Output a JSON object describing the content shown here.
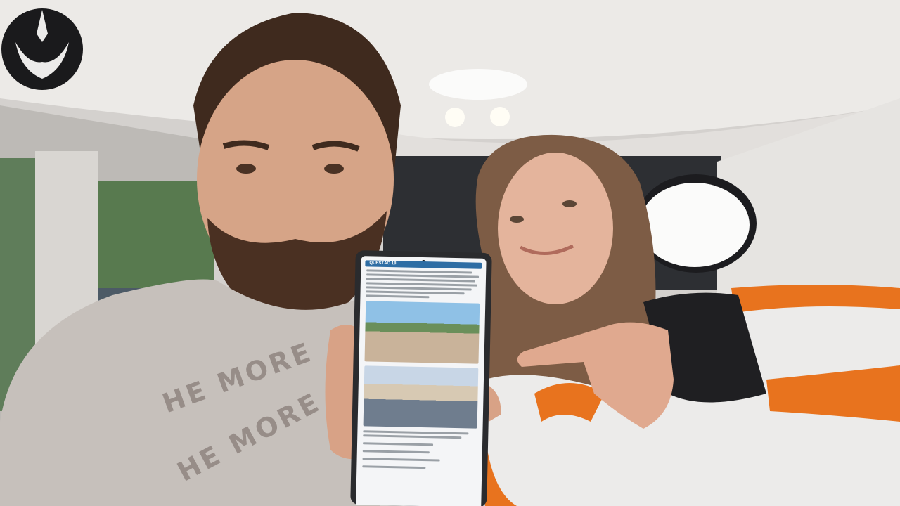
{
  "scene": {
    "description_icons": [
      "ceiling-lights",
      "softbox-light",
      "rebel-alliance-logo"
    ],
    "shirt_print": [
      "HE MORE",
      "HE MORE"
    ],
    "phone": {
      "question_label": "QUESTÃO 18",
      "colors": {
        "header": "#2e6da4",
        "screen": "#f4f5f7"
      }
    },
    "colors": {
      "wall": "#d8d6d3",
      "ceiling": "#ece9e6",
      "tshirt": "#c6c0bb",
      "jacket_orange": "#e8731e",
      "jacket_white": "#ecebea",
      "jacket_black": "#1f1f22"
    }
  }
}
